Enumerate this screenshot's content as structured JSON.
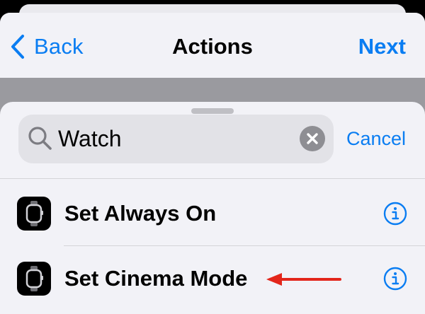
{
  "nav": {
    "back_label": "Back",
    "title": "Actions",
    "next_label": "Next"
  },
  "search": {
    "value": "Watch",
    "cancel_label": "Cancel"
  },
  "results": [
    {
      "label": "Set Always On",
      "icon": "watch-icon",
      "annotated": false
    },
    {
      "label": "Set Cinema Mode",
      "icon": "watch-icon",
      "annotated": true
    }
  ],
  "colors": {
    "accent": "#0a7df2",
    "annotation_arrow": "#e3261b",
    "sheet_background": "#f2f2f7",
    "dimmed_background": "#9a9a9f"
  }
}
